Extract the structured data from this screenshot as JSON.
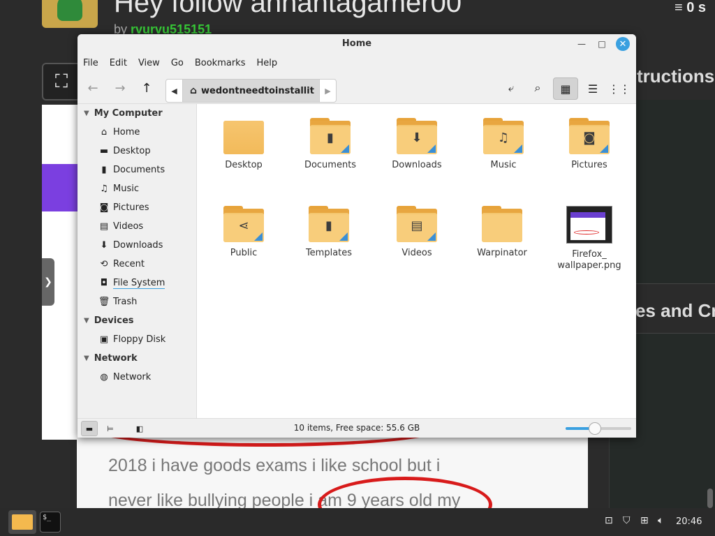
{
  "background": {
    "page_title": "Hey follow annantagamer00",
    "by_prefix": "by",
    "author": "rvurvu515151",
    "stats": "0 s",
    "heading_right_1": "tructions",
    "heading_right_2": "es and Cr",
    "essay_line_1": "2018 i have goods exams i like school but i",
    "essay_line_2": "never like bullying people i am 9 years old my"
  },
  "window": {
    "title": "Home",
    "menu": [
      "File",
      "Edit",
      "View",
      "Go",
      "Bookmarks",
      "Help"
    ],
    "path": "wedontneedtoinstallit"
  },
  "sidebar": {
    "sections": [
      {
        "title": "My Computer",
        "items": [
          {
            "label": "Home",
            "icon": "home-icon"
          },
          {
            "label": "Desktop",
            "icon": "desktop-icon"
          },
          {
            "label": "Documents",
            "icon": "document-icon"
          },
          {
            "label": "Music",
            "icon": "music-icon"
          },
          {
            "label": "Pictures",
            "icon": "camera-icon"
          },
          {
            "label": "Videos",
            "icon": "film-icon"
          },
          {
            "label": "Downloads",
            "icon": "download-icon"
          },
          {
            "label": "Recent",
            "icon": "recent-icon"
          },
          {
            "label": "File System",
            "icon": "drive-icon"
          },
          {
            "label": "Trash",
            "icon": "trash-icon"
          }
        ]
      },
      {
        "title": "Devices",
        "items": [
          {
            "label": "Floppy Disk",
            "icon": "floppy-icon"
          }
        ]
      },
      {
        "title": "Network",
        "items": [
          {
            "label": "Network",
            "icon": "globe-icon"
          }
        ]
      }
    ]
  },
  "files": [
    {
      "name": "Desktop",
      "type": "folder-plain"
    },
    {
      "name": "Documents",
      "type": "folder",
      "emblem": "document"
    },
    {
      "name": "Downloads",
      "type": "folder",
      "emblem": "download"
    },
    {
      "name": "Music",
      "type": "folder",
      "emblem": "music"
    },
    {
      "name": "Pictures",
      "type": "folder",
      "emblem": "camera"
    },
    {
      "name": "Public",
      "type": "folder",
      "emblem": "share"
    },
    {
      "name": "Templates",
      "type": "folder",
      "emblem": "template"
    },
    {
      "name": "Videos",
      "type": "folder",
      "emblem": "film"
    },
    {
      "name": "Warpinator",
      "type": "folder",
      "emblem": ""
    },
    {
      "name": "Firefox_\nwallpaper.png",
      "type": "image"
    }
  ],
  "statusbar": {
    "text": "10 items, Free space: 55.6 GB",
    "zoom_fraction": 0.45
  },
  "taskbar": {
    "clock": "20:46",
    "terminal_prompt": "$_"
  },
  "colors": {
    "accent": "#3aa0e0",
    "folder": "#f4c66f",
    "author_green": "#37c837",
    "annotation_red": "#d81b1b"
  }
}
